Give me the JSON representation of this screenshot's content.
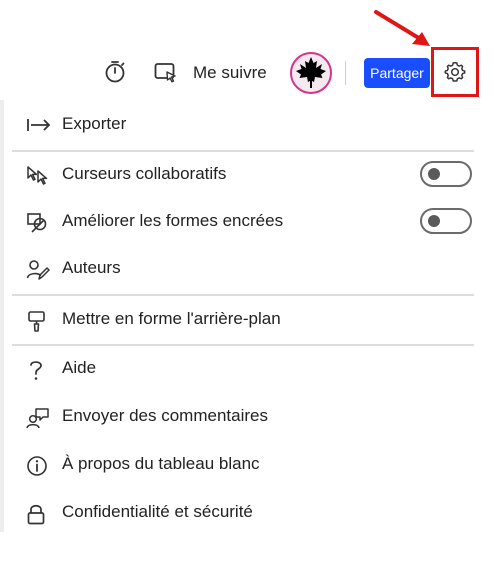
{
  "topbar": {
    "timer_icon": "timer-icon",
    "follow_icon": "follow-screen-icon",
    "follow_label": "Me suivre",
    "avatar_icon": "maple-leaf-icon",
    "share_label": "Partager",
    "settings_icon": "gear-icon",
    "annotation_color": "#e01515"
  },
  "menu": {
    "export": {
      "label": "Exporter",
      "icon": "export-arrow-icon"
    },
    "collab_cursors": {
      "label": "Curseurs collaboratifs",
      "icon": "collab-cursor-icon",
      "toggle_on": false
    },
    "ink_shapes": {
      "label": "Améliorer les formes encrées",
      "icon": "ink-shape-icon",
      "toggle_on": false
    },
    "authors": {
      "label": "Auteurs",
      "icon": "authors-icon"
    },
    "background": {
      "label": "Mettre en forme l'arrière-plan",
      "icon": "paint-bucket-icon"
    },
    "help": {
      "label": "Aide",
      "icon": "question-icon"
    },
    "feedback": {
      "label": "Envoyer des commentaires",
      "icon": "feedback-icon"
    },
    "about": {
      "label": "À propos du tableau blanc",
      "icon": "info-icon"
    },
    "privacy": {
      "label": "Confidentialité et sécurité",
      "icon": "lock-icon"
    }
  },
  "colors": {
    "share_button": "#1a4dff",
    "highlight_box": "#e01515",
    "avatar_ring": "#d6348a"
  }
}
